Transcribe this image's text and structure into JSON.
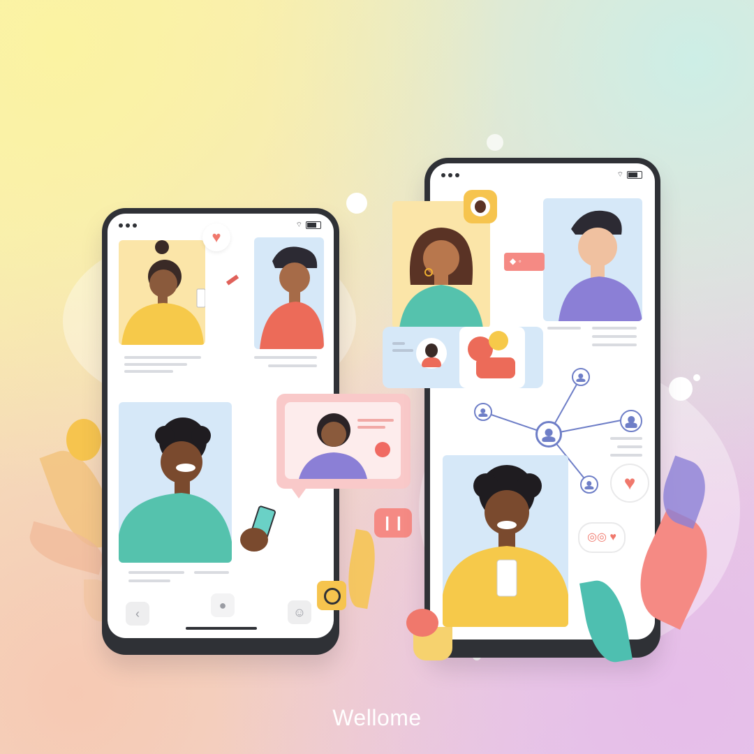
{
  "footer": {
    "brand_text": "Wellome"
  },
  "colors": {
    "phone_frame": "#2f3136",
    "accent_heart": "#f0786c",
    "network_blue": "#6e7ec7",
    "tile_yellow": "#fbe5a8",
    "tile_blue": "#d6e8f8",
    "bubble_pink": "#f9c9c9"
  },
  "icons": {
    "left_phone": [
      "heart-icon",
      "back-icon",
      "chat-icon",
      "profile-icon",
      "circle-notification-icon"
    ],
    "right_phone": [
      "avatar-badge-icon",
      "connection-pill-icon",
      "network-node-icon",
      "heart-icon",
      "reaction-icon"
    ]
  }
}
